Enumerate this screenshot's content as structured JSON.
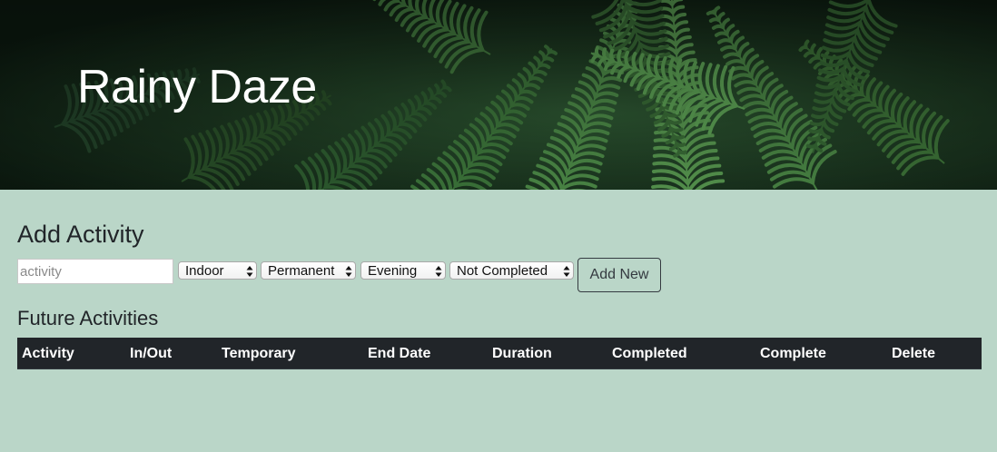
{
  "header": {
    "title": "Rainy Daze",
    "background_image": "fern-leaves"
  },
  "add_activity": {
    "heading": "Add Activity",
    "activity_input": {
      "value": "",
      "placeholder": "activity"
    },
    "location_select": {
      "selected": "Indoor"
    },
    "permanence_select": {
      "selected": "Permanent"
    },
    "time_select": {
      "selected": "Evening"
    },
    "status_select": {
      "selected": "Not Completed"
    },
    "add_button_label": "Add New"
  },
  "future_activities": {
    "heading": "Future Activities",
    "columns": [
      "Activity",
      "In/Out",
      "Temporary",
      "End Date",
      "Duration",
      "Completed",
      "Complete",
      "Delete"
    ],
    "rows": []
  },
  "colors": {
    "page_background": "#bad6c8",
    "table_header_background": "#212529",
    "header_text": "#ffffff",
    "button_border": "#343a40"
  }
}
